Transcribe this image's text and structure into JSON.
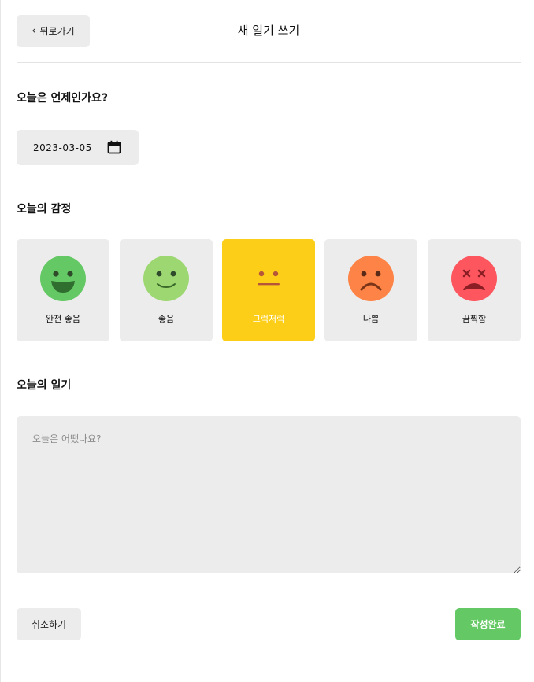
{
  "header": {
    "back_label": "뒤로가기",
    "title": "새 일기 쓰기"
  },
  "date_section": {
    "title": "오늘은 언제인가요?",
    "value": "2023-03-05"
  },
  "emotion_section": {
    "title": "오늘의 감정",
    "selected_index": 2,
    "items": [
      {
        "label": "완전 좋음",
        "color": "#64c964",
        "icon": "very-happy-face-icon"
      },
      {
        "label": "좋음",
        "color": "#9dd772",
        "icon": "happy-face-icon"
      },
      {
        "label": "그럭저럭",
        "color": "#fdce17",
        "icon": "neutral-face-icon"
      },
      {
        "label": "나쁨",
        "color": "#fd8446",
        "icon": "sad-face-icon"
      },
      {
        "label": "끔찍함",
        "color": "#fd565f",
        "icon": "terrible-face-icon"
      }
    ]
  },
  "diary_section": {
    "title": "오늘의 일기",
    "placeholder": "오늘은 어땠나요?"
  },
  "footer": {
    "cancel_label": "취소하기",
    "submit_label": "작성완료"
  },
  "colors": {
    "accent_green": "#64c964",
    "selected_yellow": "#fdce17",
    "surface_gray": "#ececec"
  }
}
